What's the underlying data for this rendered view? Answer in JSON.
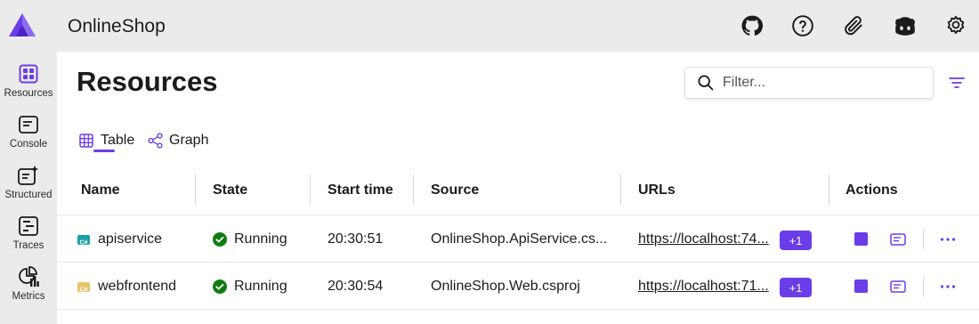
{
  "app": {
    "title": "OnlineShop"
  },
  "header_icons": [
    "github-icon",
    "help-icon",
    "paperclip-icon",
    "copilot-icon",
    "settings-icon"
  ],
  "nav": {
    "items": [
      {
        "label": "Resources",
        "icon": "grid-icon",
        "active": true
      },
      {
        "label": "Console",
        "icon": "console-icon"
      },
      {
        "label": "Structured",
        "icon": "structured-icon"
      },
      {
        "label": "Traces",
        "icon": "traces-icon"
      },
      {
        "label": "Metrics",
        "icon": "metrics-icon"
      }
    ]
  },
  "page": {
    "title": "Resources"
  },
  "filter": {
    "placeholder": "Filter..."
  },
  "tabs": [
    {
      "label": "Table",
      "icon": "table-icon",
      "active": true
    },
    {
      "label": "Graph",
      "icon": "graph-icon"
    }
  ],
  "table": {
    "columns": [
      "Name",
      "State",
      "Start time",
      "Source",
      "URLs",
      "Actions"
    ],
    "rows": [
      {
        "name": "apiservice",
        "type_icon": "csharp-icon",
        "state": "Running",
        "start_time": "20:30:51",
        "source": "OnlineShop.ApiService.cs...",
        "url": "https://localhost:74...",
        "more_urls": "+1"
      },
      {
        "name": "webfrontend",
        "type_icon": "csharp-icon",
        "state": "Running",
        "start_time": "20:30:54",
        "source": "OnlineShop.Web.csproj",
        "url": "https://localhost:71...",
        "more_urls": "+1"
      }
    ]
  },
  "colors": {
    "accent": "#6a3de8",
    "running": "#107c10",
    "chrome": "#ebebeb"
  }
}
